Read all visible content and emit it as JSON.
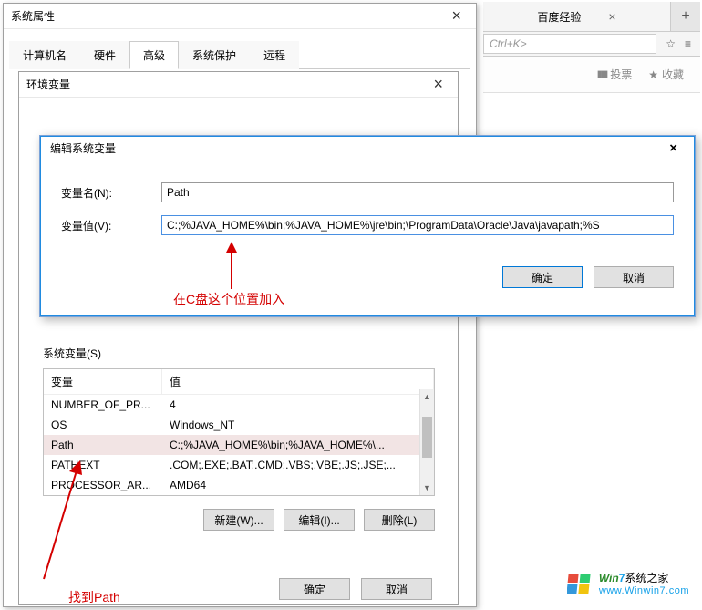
{
  "browser": {
    "tab1": "百度经验",
    "tab1_close": "×",
    "newtab": "+",
    "addr_placeholder": "Ctrl+K>",
    "star_glyph": "☆",
    "menu_glyph": "≡",
    "toolbar_vote": "投票",
    "toolbar_fav": "收藏",
    "vote_icon": "▮▮▮",
    "fav_icon": "★"
  },
  "sysprops": {
    "title": "系统属性",
    "close": "×",
    "tabs": {
      "t1": "计算机名",
      "t2": "硬件",
      "t3": "高级",
      "t4": "系统保护",
      "t5": "远程"
    }
  },
  "envdlg": {
    "title": "环境变量",
    "close": "×",
    "section_label": "系统变量(S)",
    "col_var": "变量",
    "col_val": "值",
    "rows": [
      {
        "k": "NUMBER_OF_PR...",
        "v": "4"
      },
      {
        "k": "OS",
        "v": "Windows_NT"
      },
      {
        "k": "Path",
        "v": "C:;%JAVA_HOME%\\bin;%JAVA_HOME%\\..."
      },
      {
        "k": "PATHEXT",
        "v": ".COM;.EXE;.BAT;.CMD;.VBS;.VBE;.JS;.JSE;..."
      },
      {
        "k": "PROCESSOR_AR...",
        "v": "AMD64"
      }
    ],
    "buttons": {
      "new": "新建(W)...",
      "edit": "编辑(I)...",
      "del": "删除(L)"
    },
    "bottom": {
      "ok": "确定",
      "cancel": "取消"
    }
  },
  "editdlg": {
    "title": "编辑系统变量",
    "close": "×",
    "name_label": "变量名(N):",
    "name_value": "Path",
    "value_label": "变量值(V):",
    "value_value": "C:;%JAVA_HOME%\\bin;%JAVA_HOME%\\jre\\bin;\\ProgramData\\Oracle\\Java\\javapath;%S",
    "ok": "确定",
    "cancel": "取消"
  },
  "annotations": {
    "a1": "在C盘这个位置加入",
    "a2": "找到Path"
  },
  "watermark": {
    "top_win": "Win",
    "top_seven": "7",
    "top_rest": "系统之家",
    "bottom": "www.Winwin7.com"
  }
}
